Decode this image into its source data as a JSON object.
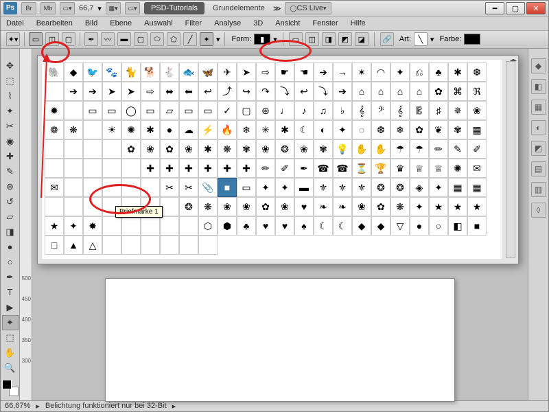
{
  "titlebar": {
    "ps": "Ps",
    "br": "Br",
    "mb": "Mb",
    "zoom": "66,7",
    "tab_psd": "PSD-Tutorials",
    "tab_doc": "Grundelemente",
    "cs": "CS Live"
  },
  "menu": [
    "Datei",
    "Bearbeiten",
    "Bild",
    "Ebene",
    "Auswahl",
    "Filter",
    "Analyse",
    "3D",
    "Ansicht",
    "Fenster",
    "Hilfe"
  ],
  "optbar": {
    "form": "Form:",
    "art": "Art:",
    "farbe": "Farbe:"
  },
  "ruler_ticks": [
    "500",
    "450",
    "400",
    "350",
    "300"
  ],
  "status": {
    "zoom": "66,67%",
    "msg": "Belichtung funktioniert nur bei 32-Bit"
  },
  "tooltip": "Briefmarke 1",
  "shape_glyphs": [
    "🐘",
    "◆",
    "🐦",
    "🐾",
    "🐈",
    "🐕",
    "🐇",
    "🐟",
    "🦋",
    "✈",
    "➤",
    "⇨",
    "☛",
    "☚",
    "➔",
    "→",
    "✶",
    "◠",
    "✦",
    "⎌",
    "♣",
    "✱",
    "❆",
    "",
    "➔",
    "➔",
    "➤",
    "➤",
    "⇨",
    "⬌",
    "⬅",
    "↩",
    "⤴",
    "↪",
    "↷",
    "⤵",
    "↩",
    "⤵",
    "➔",
    "⌂",
    "⌂",
    "⌂",
    "⌂",
    "✿",
    "⌘",
    "ℜ",
    "✹",
    "",
    "▭",
    "▭",
    "◯",
    "▭",
    "▱",
    "▭",
    "▭",
    "✓",
    "▢",
    "⊛",
    "♩",
    "♪",
    "♫",
    "♭",
    "𝄞",
    "𝄢",
    "𝄞",
    "𝄡",
    "♯",
    "✵",
    "❀",
    "❁",
    "❋",
    "",
    "☀",
    "✺",
    "✱",
    "●",
    "☁",
    "⚡",
    "🔥",
    "❄",
    "✳",
    "✱",
    "☾",
    "◐",
    "✦",
    "◌",
    "❆",
    "❄",
    "✿",
    "❦",
    "✾",
    "▦",
    "",
    "",
    "",
    "",
    "✿",
    "❀",
    "✿",
    "❀",
    "✱",
    "❋",
    "✾",
    "❀",
    "❂",
    "❀",
    "✾",
    "💡",
    "✋",
    "✋",
    "☂",
    "☂",
    "✏",
    "✎",
    "✐",
    "",
    "",
    "",
    "",
    "",
    "✚",
    "✚",
    "✚",
    "✚",
    "✚",
    "✚",
    "✏",
    "✐",
    "✒",
    "☎",
    "☎",
    "⏳",
    "🏆",
    "♛",
    "♕",
    "♕",
    "✺",
    "✉",
    "✉",
    "",
    "",
    "",
    "",
    "",
    "✂",
    "✂",
    "📎",
    "■",
    "▭",
    "✦",
    "✦",
    "▬",
    "⚜",
    "⚜",
    "⚜",
    "❂",
    "❂",
    "◈",
    "✦",
    "▦",
    "▦",
    "",
    "",
    "",
    "",
    "",
    "",
    "",
    "❂",
    "❋",
    "❀",
    "❀",
    "✿",
    "❀",
    "♥",
    "❧",
    "❧",
    "❀",
    "✿",
    "❋",
    "✦",
    "★",
    "★",
    "★",
    "★",
    "✦",
    "✸",
    "",
    "",
    "",
    "",
    "",
    "⬡",
    "⬢",
    "♣",
    "♥",
    "♥",
    "♠",
    "☾",
    "☾",
    "◆",
    "◆",
    "▽",
    "●",
    "○",
    "◧",
    "■",
    "□",
    "▲",
    "△",
    "",
    "",
    "",
    "",
    "",
    ""
  ]
}
